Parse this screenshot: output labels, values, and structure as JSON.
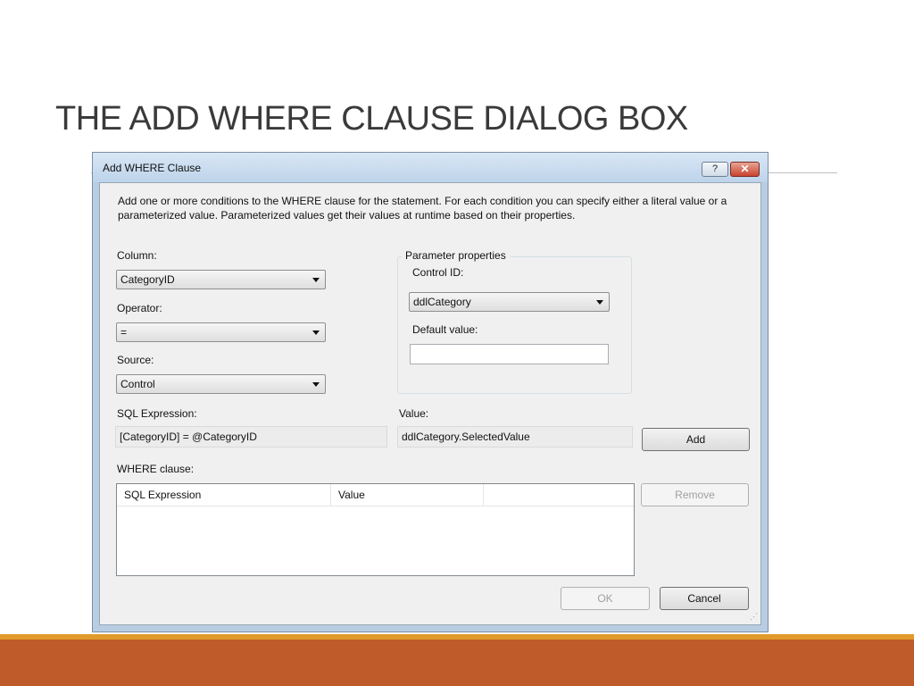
{
  "slide": {
    "title": "THE ADD WHERE CLAUSE DIALOG BOX"
  },
  "dialog": {
    "title": "Add WHERE Clause",
    "help_label": "?",
    "close_label": "✕",
    "description": "Add one or more conditions to the WHERE clause for the statement. For each condition you can specify either a literal value or a parameterized value. Parameterized values get their values at runtime based on their properties.",
    "column": {
      "label": "Column:",
      "value": "CategoryID"
    },
    "operator": {
      "label": "Operator:",
      "value": "="
    },
    "source": {
      "label": "Source:",
      "value": "Control"
    },
    "parameter_properties": {
      "legend": "Parameter properties",
      "control_id_label": "Control ID:",
      "control_id_value": "ddlCategory",
      "default_value_label": "Default value:",
      "default_value": ""
    },
    "sql_expression": {
      "label": "SQL Expression:",
      "value": "[CategoryID] = @CategoryID"
    },
    "value": {
      "label": "Value:",
      "value": "ddlCategory.SelectedValue"
    },
    "add_label": "Add",
    "where_clause": {
      "label": "WHERE clause:",
      "columns": [
        "SQL Expression",
        "Value",
        ""
      ]
    },
    "remove_label": "Remove",
    "ok_label": "OK",
    "cancel_label": "Cancel"
  }
}
